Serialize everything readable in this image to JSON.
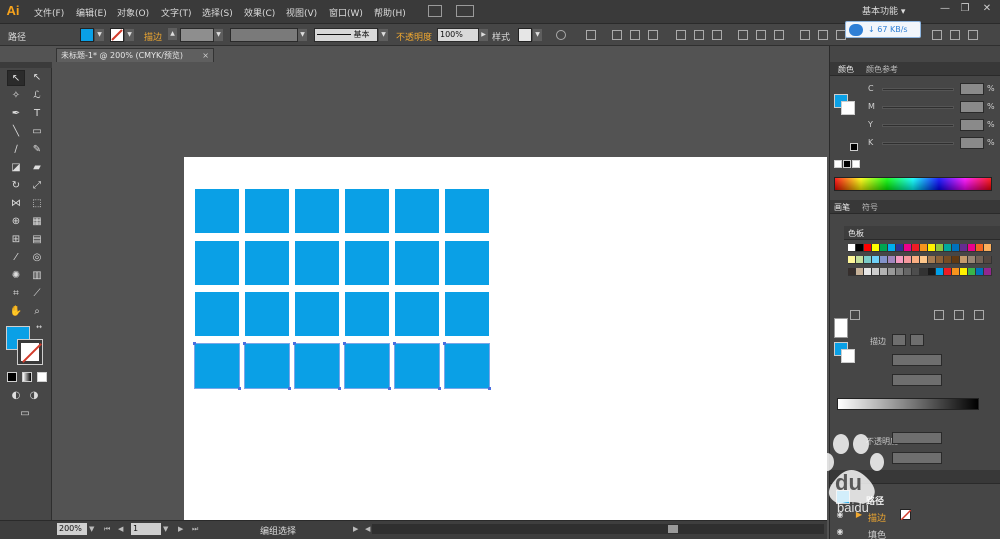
{
  "app": {
    "logo_text": "Ai"
  },
  "menu": {
    "items": [
      "文件(F)",
      "编辑(E)",
      "对象(O)",
      "文字(T)",
      "选择(S)",
      "效果(C)",
      "视图(V)",
      "窗口(W)",
      "帮助(H)"
    ],
    "workspace": "基本功能"
  },
  "control_bar": {
    "selection_label": "路径",
    "stroke_label": "描边",
    "stroke_style": "基本",
    "opacity_label": "不透明度",
    "opacity_value": "100%",
    "style_label": "样式",
    "fill_color": "#0aa0e6"
  },
  "speed_badge": {
    "text": "67 KB/s"
  },
  "document": {
    "tab_title": "未标题-1* @ 200% (CMYK/预览)",
    "close_glyph": "×"
  },
  "artwork": {
    "square_color": "#0aa0e6",
    "rows": 4,
    "columns": 6,
    "selected_row": 4
  },
  "status_bar": {
    "zoom": "200%",
    "artboard_number": "1",
    "status_text": "编组选择"
  },
  "color_panel": {
    "tabs": [
      "颜色",
      "颜色参考"
    ],
    "channels": [
      "C",
      "M",
      "Y",
      "K"
    ],
    "percent_sign": "%"
  },
  "swatches_panel": {
    "tabs": [
      "画笔",
      "符号"
    ],
    "title": "色板",
    "colors": [
      "#ffffff",
      "#000000",
      "#ff0000",
      "#ffff00",
      "#00a651",
      "#00aeef",
      "#2e3192",
      "#ec008c",
      "#ed1c24",
      "#f7941d",
      "#fff200",
      "#8dc63f",
      "#00a99d",
      "#0072bc",
      "#662d91",
      "#ec008c",
      "#f26522",
      "#fbaf5d",
      "#fff799",
      "#c4df9b",
      "#7accc8",
      "#6dcff6",
      "#8393ca",
      "#a186be",
      "#f49ac1",
      "#f5989d",
      "#f9ad81",
      "#fdc68a",
      "#a67c52",
      "#8c6239",
      "#754c24",
      "#603913",
      "#c69c6d",
      "#998675",
      "#736357",
      "#534741",
      "#362f2d",
      "#c7b299",
      "#e6e6e6",
      "#cccccc",
      "#b3b3b3",
      "#999999",
      "#808080",
      "#666666",
      "#4d4d4d",
      "#333333",
      "#1a1a1a",
      "#00a0e9",
      "#ed1c24",
      "#f7941d",
      "#fff200",
      "#39b54a",
      "#0072bc",
      "#92278f"
    ]
  },
  "appearance_panel": {
    "stroke_label": "描边",
    "opacity_label": "不透明度"
  },
  "layers": {
    "name": "路径",
    "stroke_row": "描边",
    "second_row": "填色"
  },
  "watermark": {
    "text": "du baidu"
  }
}
